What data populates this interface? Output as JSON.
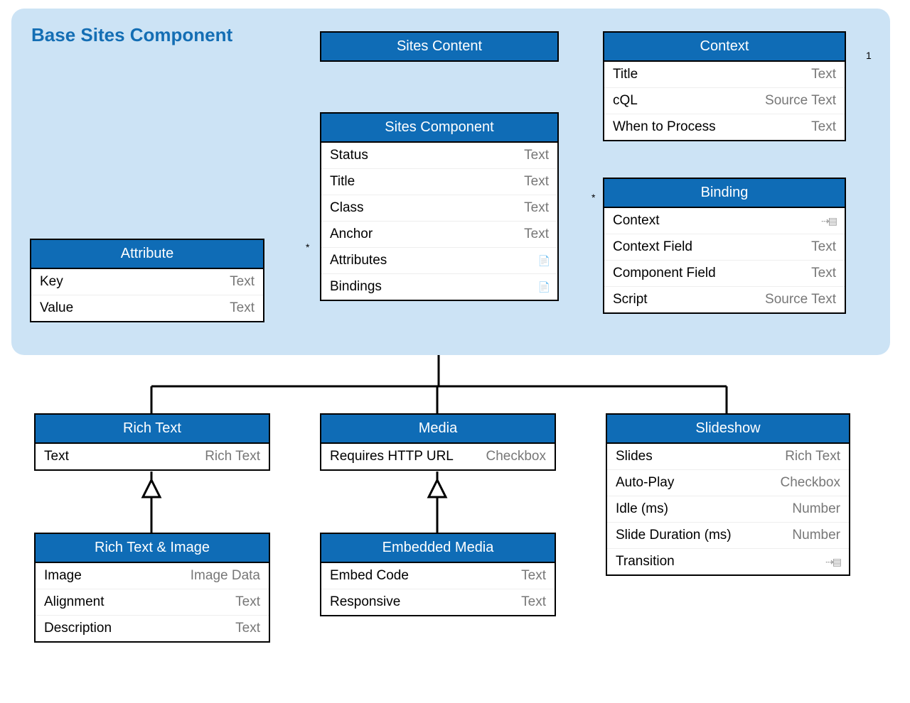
{
  "colors": {
    "accent": "#0f6cb6",
    "panel": "#cce3f5",
    "title": "#146eb4"
  },
  "panel": {
    "title": "Base Sites Component"
  },
  "sitesContent": {
    "title": "Sites Content"
  },
  "sitesComponent": {
    "title": "Sites Component",
    "rows": [
      {
        "label": "Status",
        "type": "Text"
      },
      {
        "label": "Title",
        "type": "Text"
      },
      {
        "label": "Class",
        "type": "Text"
      },
      {
        "label": "Anchor",
        "type": "Text"
      },
      {
        "label": "Attributes",
        "icon": "📄"
      },
      {
        "label": "Bindings",
        "icon": "📄"
      }
    ]
  },
  "attribute": {
    "title": "Attribute",
    "rows": [
      {
        "label": "Key",
        "type": "Text"
      },
      {
        "label": "Value",
        "type": "Text"
      }
    ]
  },
  "context": {
    "title": "Context",
    "rows": [
      {
        "label": "Title",
        "type": "Text"
      },
      {
        "label": "cQL",
        "type": "Source Text"
      },
      {
        "label": "When to Process",
        "type": "Text"
      }
    ]
  },
  "binding": {
    "title": "Binding",
    "rows": [
      {
        "label": "Context",
        "icon": "⇢▤"
      },
      {
        "label": "Context Field",
        "type": "Text"
      },
      {
        "label": "Component Field",
        "type": "Text"
      },
      {
        "label": "Script",
        "type": "Source Text"
      }
    ]
  },
  "richText": {
    "title": "Rich Text",
    "rows": [
      {
        "label": "Text",
        "type": "Rich Text"
      }
    ]
  },
  "media": {
    "title": "Media",
    "rows": [
      {
        "label": "Requires HTTP URL",
        "type": "Checkbox"
      }
    ]
  },
  "slideshow": {
    "title": "Slideshow",
    "rows": [
      {
        "label": "Slides",
        "type": "Rich Text"
      },
      {
        "label": "Auto-Play",
        "type": "Checkbox"
      },
      {
        "label": "Idle (ms)",
        "type": "Number"
      },
      {
        "label": "Slide Duration (ms)",
        "type": "Number"
      },
      {
        "label": "Transition",
        "icon": "⇢▤"
      }
    ]
  },
  "richTextImage": {
    "title": "Rich Text & Image",
    "rows": [
      {
        "label": "Image",
        "type": "Image Data"
      },
      {
        "label": "Alignment",
        "type": "Text"
      },
      {
        "label": "Description",
        "type": "Text"
      }
    ]
  },
  "embeddedMedia": {
    "title": "Embedded Media",
    "rows": [
      {
        "label": "Embed Code",
        "type": "Text"
      },
      {
        "label": "Responsive",
        "type": "Text"
      }
    ]
  },
  "mult": {
    "star": "*",
    "one": "1"
  }
}
